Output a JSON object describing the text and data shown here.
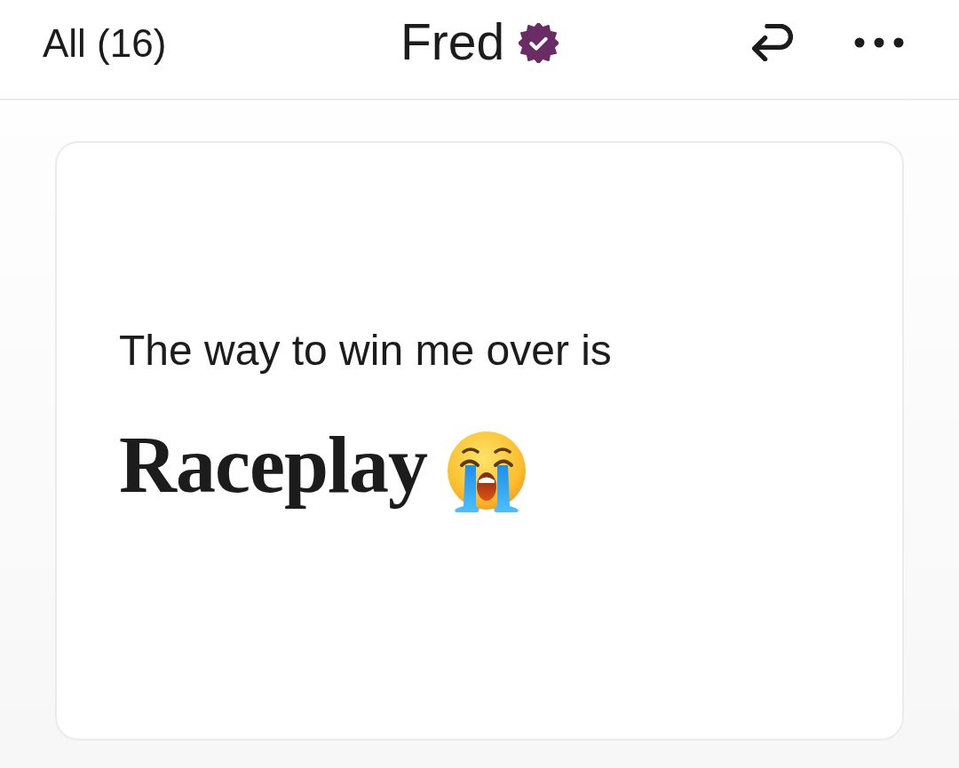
{
  "header": {
    "back_label": "All (16)",
    "title": "Fred",
    "verified": true
  },
  "prompt_card": {
    "question": "The way to win me over is",
    "answer": "Raceplay"
  }
}
